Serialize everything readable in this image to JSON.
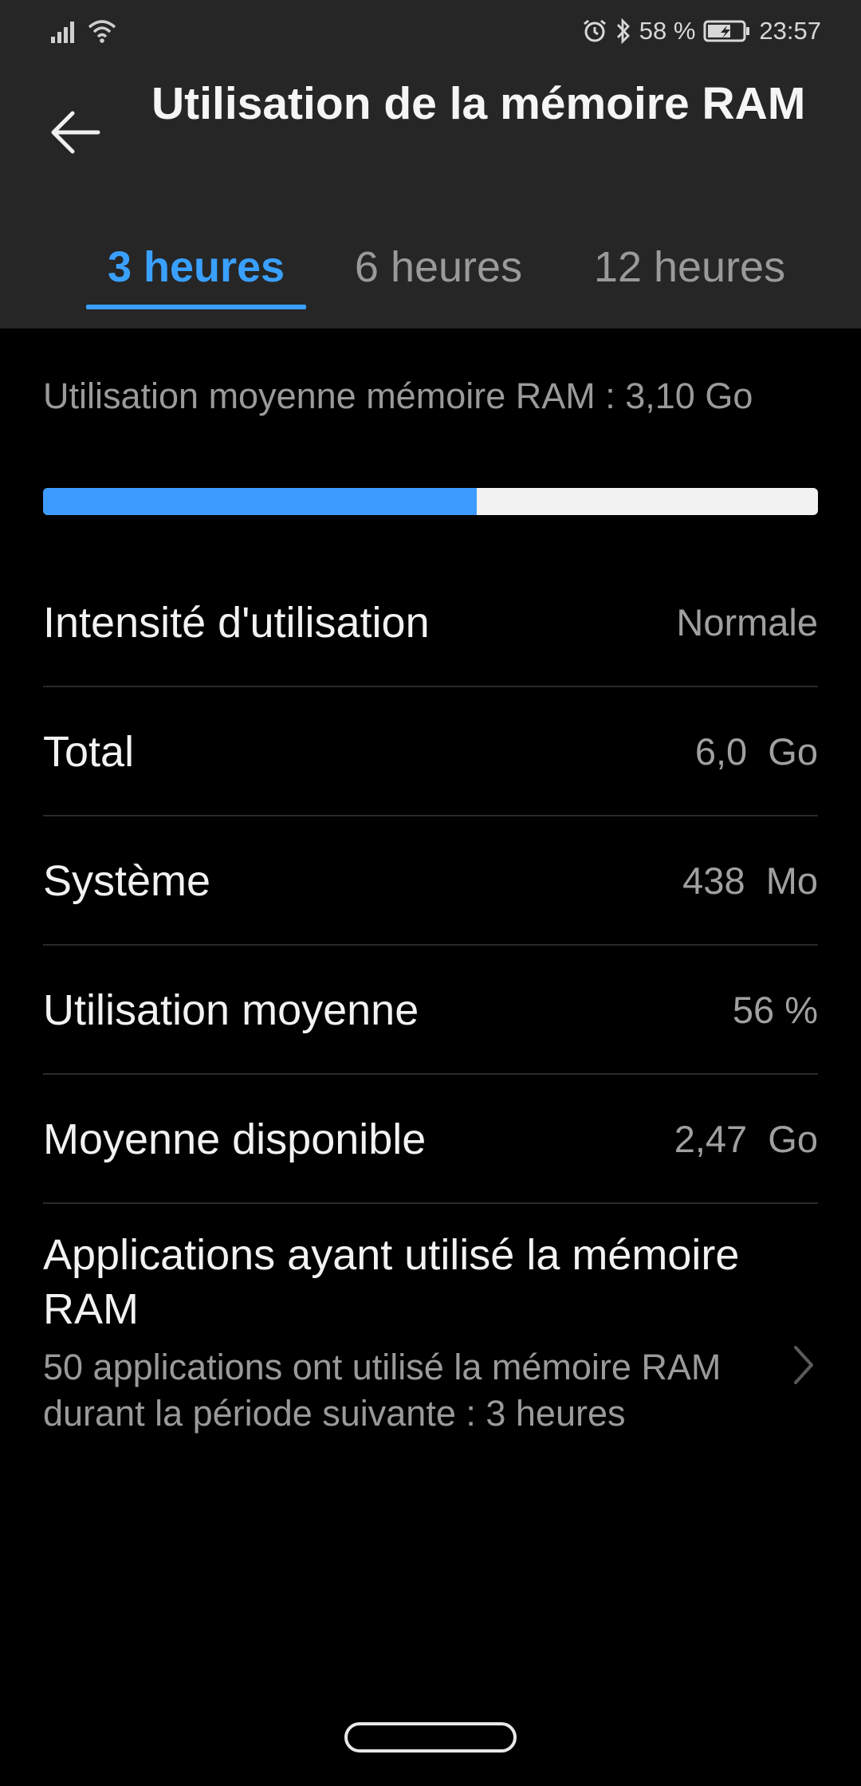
{
  "status_bar": {
    "battery": "58 %",
    "time": "23:57"
  },
  "header": {
    "title": "Utilisation de la mémoire RAM"
  },
  "tabs": [
    {
      "label": "3 heures",
      "active": true
    },
    {
      "label": "6 heures",
      "active": false
    },
    {
      "label": "12 heures",
      "active": false
    }
  ],
  "summary": {
    "label": "Utilisation moyenne mémoire RAM : 3,10 Go",
    "usage_fraction": 0.56,
    "bar_color": "#3d9bff"
  },
  "rows": [
    {
      "label": "Intensité d'utilisation",
      "value": "Normale"
    },
    {
      "label": "Total",
      "value": "6,0  Go"
    },
    {
      "label": "Système",
      "value": "438  Mo"
    },
    {
      "label": "Utilisation moyenne",
      "value": "56 %"
    },
    {
      "label": "Moyenne disponible",
      "value": "2,47  Go"
    }
  ],
  "apps_entry": {
    "title": "Applications ayant utilisé la mémoire RAM",
    "subtitle": "50 applications ont utilisé la mémoire RAM durant la période suivante : 3 heures"
  },
  "colors": {
    "accent": "#3aa0ff",
    "header_bg": "#262626",
    "page_bg": "#000000"
  }
}
